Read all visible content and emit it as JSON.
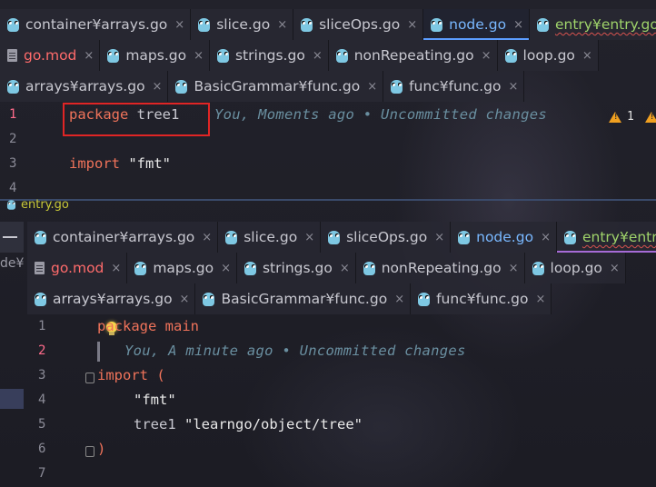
{
  "top_pane": {
    "tab_rows": [
      [
        {
          "label": "container¥arrays.go",
          "icon": "gopher-icon",
          "style": "normal"
        },
        {
          "label": "slice.go",
          "icon": "gopher-icon",
          "style": "normal"
        },
        {
          "label": "sliceOps.go",
          "icon": "gopher-icon",
          "style": "normal"
        },
        {
          "label": "node.go",
          "icon": "gopher-icon",
          "style": "blue",
          "active": true
        },
        {
          "label": "entry¥entry.go",
          "icon": "gopher-icon",
          "style": "green"
        }
      ],
      [
        {
          "label": "go.mod",
          "icon": "file-icon",
          "style": "red"
        },
        {
          "label": "maps.go",
          "icon": "gopher-icon",
          "style": "normal"
        },
        {
          "label": "strings.go",
          "icon": "gopher-icon",
          "style": "normal"
        },
        {
          "label": "nonRepeating.go",
          "icon": "gopher-icon",
          "style": "normal"
        },
        {
          "label": "loop.go",
          "icon": "gopher-icon",
          "style": "normal"
        }
      ],
      [
        {
          "label": "arrays¥arrays.go",
          "icon": "gopher-icon",
          "style": "normal"
        },
        {
          "label": "BasicGrammar¥func.go",
          "icon": "gopher-icon",
          "style": "normal"
        },
        {
          "label": "func¥func.go",
          "icon": "gopher-icon",
          "style": "normal"
        }
      ]
    ],
    "close_glyph": "×",
    "line_numbers": [
      "1",
      "2",
      "3",
      "4"
    ],
    "code": {
      "line1_keyword": "package",
      "line1_name": "tree1",
      "line1_hint": "You, Moments ago • Uncommitted changes",
      "line3_keyword": "import",
      "line3_string": "\"fmt\""
    },
    "warnings": {
      "count": "1",
      "icon": "warning-triangle-icon"
    }
  },
  "bottom_pane": {
    "file_label": "entry.go",
    "side_label": "de¥",
    "tab_rows": [
      [
        {
          "label": "container¥arrays.go",
          "icon": "gopher-icon",
          "style": "normal"
        },
        {
          "label": "slice.go",
          "icon": "gopher-icon",
          "style": "normal"
        },
        {
          "label": "sliceOps.go",
          "icon": "gopher-icon",
          "style": "normal"
        },
        {
          "label": "node.go",
          "icon": "gopher-icon",
          "style": "blue"
        },
        {
          "label": "entry¥entry.",
          "icon": "gopher-icon",
          "style": "green",
          "active": true
        }
      ],
      [
        {
          "label": "go.mod",
          "icon": "file-icon",
          "style": "red"
        },
        {
          "label": "maps.go",
          "icon": "gopher-icon",
          "style": "normal"
        },
        {
          "label": "strings.go",
          "icon": "gopher-icon",
          "style": "normal"
        },
        {
          "label": "nonRepeating.go",
          "icon": "gopher-icon",
          "style": "normal"
        },
        {
          "label": "loop.go",
          "icon": "gopher-icon",
          "style": "normal"
        }
      ],
      [
        {
          "label": "arrays¥arrays.go",
          "icon": "gopher-icon",
          "style": "normal"
        },
        {
          "label": "BasicGrammar¥func.go",
          "icon": "gopher-icon",
          "style": "normal"
        },
        {
          "label": "func¥func.go",
          "icon": "gopher-icon",
          "style": "normal"
        }
      ]
    ],
    "close_glyph": "×",
    "line_numbers": [
      "1",
      "2",
      "3",
      "4",
      "5",
      "6",
      "7"
    ],
    "code": {
      "line1_keyword": "package",
      "line1_name": "main",
      "line2_hint": "You, A minute ago • Uncommitted changes",
      "line3_keyword": "import",
      "line3_paren": "(",
      "line4_string": "\"fmt\"",
      "line5_alias": "tree1",
      "line5_string": "\"learngo/object/tree\"",
      "line6_paren": ")"
    }
  },
  "colors": {
    "accent": "#5c9dff",
    "keyword": "#f0735a",
    "hint": "#6a8fa0",
    "highlight_box": "#e02525",
    "warning": "#f0a020"
  }
}
